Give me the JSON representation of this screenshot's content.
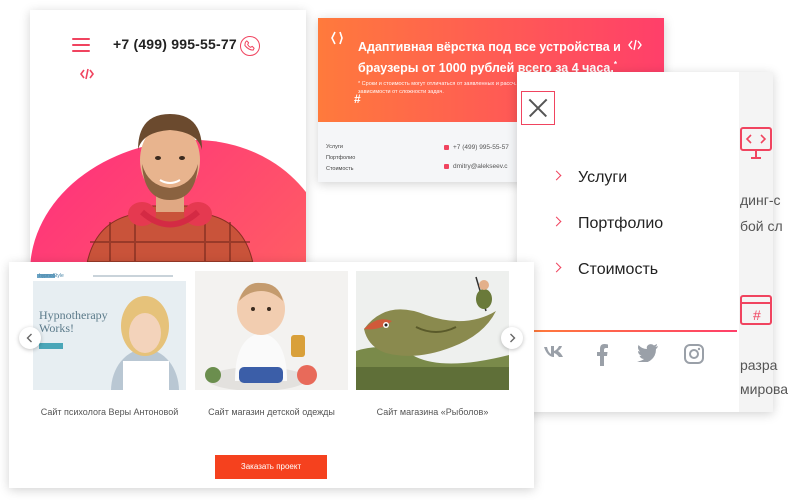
{
  "mobile": {
    "phone": "+7 (499) 995-55-77"
  },
  "banner": {
    "title": "Адаптивная вёрстка под все устройства и браузеры от 1000 рублей всего за 4 часа.",
    "title_mark": "*",
    "note": "* Сроки и стоимость могут отличаться от заявленных и рассч... зависимости от сложности задач.",
    "menu": [
      "Услуги",
      "Портфолио",
      "Стоимость"
    ],
    "phone": "+7 (499) 995-55-57",
    "email": "dmitry@alekseev.c"
  },
  "menu": {
    "items": [
      "Услуги",
      "Портфолио",
      "Стоимость"
    ],
    "side_text_1": "динг-с",
    "side_text_2": "бой сл",
    "side_text_3": "разра",
    "side_text_4": "мирова",
    "social": [
      "vk-icon",
      "facebook-icon",
      "twitter-icon",
      "instagram-icon"
    ]
  },
  "portfolio": {
    "slides": [
      {
        "caption": "Сайт психолога Веры Антоновой",
        "slide_title": "Hypnotherapy Works!",
        "slide_brand": "hypnoStyle"
      },
      {
        "caption": "Сайт магазин детской одежды"
      },
      {
        "caption": "Сайт магазина «Рыболов»"
      }
    ],
    "cta": "Заказать проект"
  },
  "colors": {
    "accent": "#f0445f",
    "orange": "#ff7a3c",
    "button": "#f5411e"
  }
}
